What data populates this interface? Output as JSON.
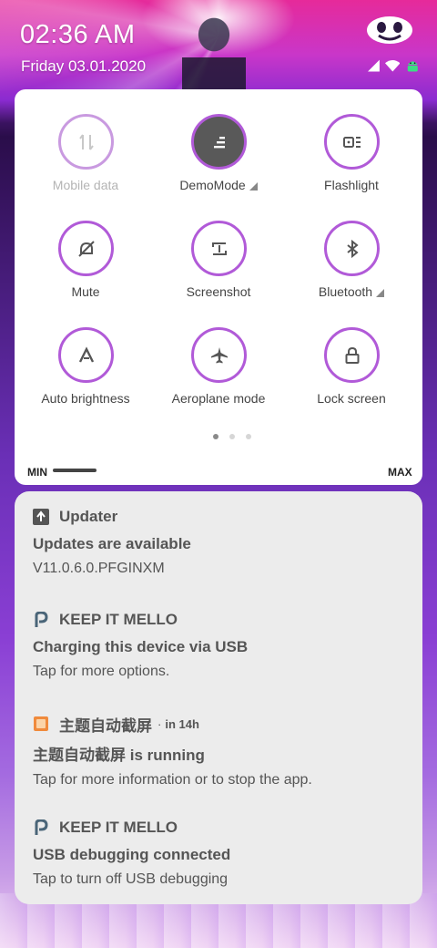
{
  "status_bar": {
    "time": "02:36 AM",
    "date": "Friday 03.01.2020",
    "icons": [
      "signal-icon",
      "wifi-icon",
      "android-debug-icon"
    ]
  },
  "quick_settings": {
    "tiles": [
      {
        "label": "Mobile data",
        "icon": "mobile-data-icon",
        "state": "disabled"
      },
      {
        "label": "DemoMode",
        "icon": "demo-mode-icon",
        "state": "active",
        "expandable": true
      },
      {
        "label": "Flashlight",
        "icon": "flashlight-icon",
        "state": "off"
      },
      {
        "label": "Mute",
        "icon": "mute-icon",
        "state": "off"
      },
      {
        "label": "Screenshot",
        "icon": "screenshot-icon",
        "state": "off"
      },
      {
        "label": "Bluetooth",
        "icon": "bluetooth-icon",
        "state": "off",
        "expandable": true
      },
      {
        "label": "Auto brightness",
        "icon": "auto-brightness-icon",
        "state": "off"
      },
      {
        "label": "Aeroplane mode",
        "icon": "aeroplane-icon",
        "state": "off"
      },
      {
        "label": "Lock screen",
        "icon": "lock-icon",
        "state": "off"
      }
    ],
    "page_count": 3,
    "current_page": 1,
    "brightness": {
      "min_label": "MIN",
      "max_label": "MAX",
      "level": 0.15
    }
  },
  "notifications": [
    {
      "app": "Updater",
      "time": "",
      "title": "Updates are available",
      "text": "V11.0.6.0.PFGINXM",
      "icon": "upload-arrow-icon"
    },
    {
      "app": "KEEP IT MELLO",
      "time": "",
      "title": "Charging this device via USB",
      "text": "Tap for more options.",
      "icon": "p-logo-icon"
    },
    {
      "app": "主题自动截屏",
      "time": "in 14h",
      "title": "主题自动截屏 is running",
      "text": "Tap for more information or to stop the app.",
      "icon": "app-square-icon"
    },
    {
      "app": "KEEP IT MELLO",
      "time": "",
      "title": "USB debugging connected",
      "text": "Tap to turn off USB debugging",
      "icon": "p-logo-icon"
    }
  ],
  "colors": {
    "tile_ring": "#b15ad8",
    "tile_active_fill": "#595959",
    "panel_bg": "#ffffff",
    "notif_bg": "#ececec"
  }
}
